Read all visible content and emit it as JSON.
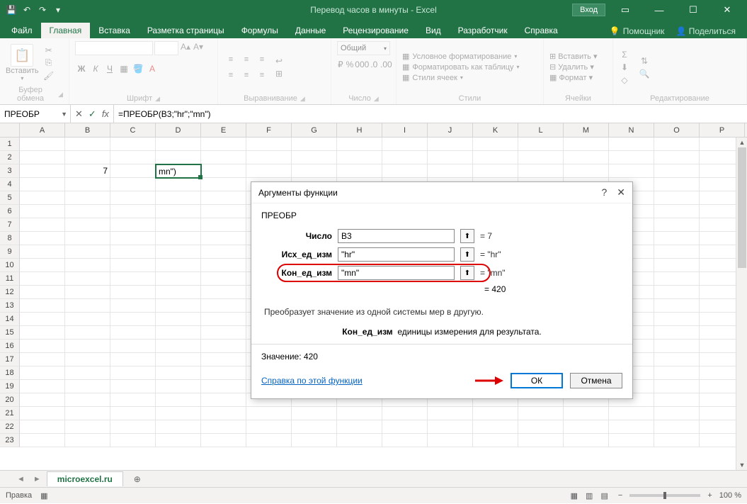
{
  "titlebar": {
    "title": "Перевод часов в минуты - Excel",
    "login": "Вход"
  },
  "tabs": {
    "file": "Файл",
    "home": "Главная",
    "insert": "Вставка",
    "layout": "Разметка страницы",
    "formulas": "Формулы",
    "data": "Данные",
    "review": "Рецензирование",
    "view": "Вид",
    "developer": "Разработчик",
    "help": "Справка",
    "tellme": "Помощник",
    "share": "Поделиться"
  },
  "ribbon": {
    "paste": "Вставить",
    "clipboard": "Буфер обмена",
    "font_label": "Шрифт",
    "align_label": "Выравнивание",
    "number_label": "Число",
    "number_format": "Общий",
    "styles_label": "Стили",
    "cond_fmt": "Условное форматирование",
    "fmt_table": "Форматировать как таблицу",
    "cell_styles": "Стили ячеек",
    "cells_label": "Ячейки",
    "insert_cells": "Вставить",
    "delete_cells": "Удалить",
    "format_cells": "Формат",
    "editing_label": "Редактирование"
  },
  "formulabar": {
    "namebox": "ПРЕОБР",
    "formula": "=ПРЕОБР(B3;\"hr\";\"mn\")"
  },
  "columns": [
    "A",
    "B",
    "C",
    "D",
    "E",
    "F",
    "G",
    "H",
    "I",
    "J",
    "K",
    "L",
    "M",
    "N",
    "O",
    "P"
  ],
  "rows": [
    "1",
    "2",
    "3",
    "4",
    "5",
    "6",
    "7",
    "8",
    "9",
    "10",
    "11",
    "12",
    "13",
    "14",
    "15",
    "16",
    "17",
    "18",
    "19",
    "20",
    "21",
    "22",
    "23"
  ],
  "cells": {
    "b3": "7",
    "d3": "mn\")"
  },
  "dialog": {
    "title": "Аргументы функции",
    "func": "ПРЕОБР",
    "arg1_label": "Число",
    "arg1_value": "B3",
    "arg1_result": "= 7",
    "arg2_label": "Исх_ед_изм",
    "arg2_value": "\"hr\"",
    "arg2_result": "= \"hr\"",
    "arg3_label": "Кон_ед_изм",
    "arg3_value": "\"mn\"",
    "arg3_result": "= \"mn\"",
    "result_label": "= 420",
    "desc": "Преобразует значение из одной системы мер в другую.",
    "arg_name": "Кон_ед_изм",
    "arg_desc": "единицы измерения для результата.",
    "value_label": "Значение:",
    "value": "420",
    "help_link": "Справка по этой функции",
    "ok": "ОК",
    "cancel": "Отмена"
  },
  "sheets": {
    "name": "microexcel.ru"
  },
  "statusbar": {
    "mode": "Правка",
    "zoom": "100 %"
  }
}
